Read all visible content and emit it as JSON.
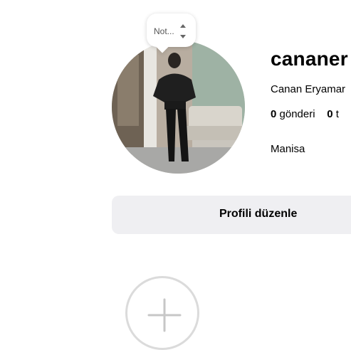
{
  "note": {
    "text": "Not..."
  },
  "profile": {
    "username": "cananer",
    "full_name": "Canan Eryamar",
    "location": "Manisa"
  },
  "stats": {
    "posts_count": "0",
    "posts_label": "gönderi",
    "followers_count": "0",
    "followers_label": "t"
  },
  "actions": {
    "edit_profile": "Profili düzenle"
  },
  "icons": {
    "note_arrows": "up-down-arrows-icon",
    "new_highlight": "plus-icon"
  },
  "colors": {
    "button_bg": "#efeff2",
    "highlight_ring": "#dbdbdb",
    "plus": "#c7c7c7"
  }
}
